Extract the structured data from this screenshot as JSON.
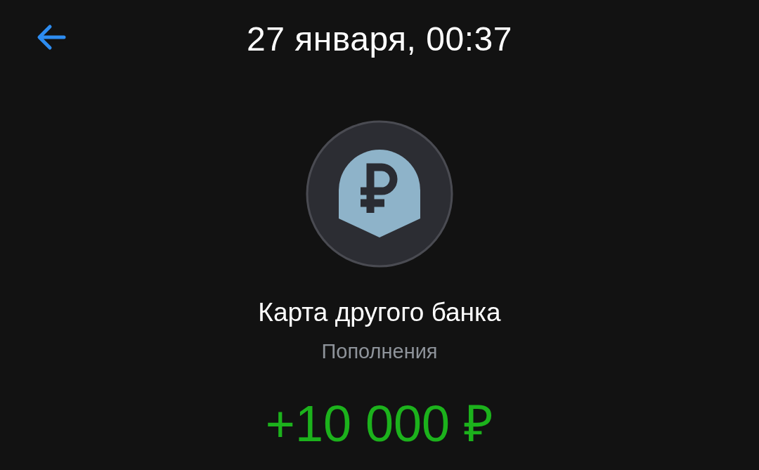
{
  "header": {
    "title": "27 января, 00:37"
  },
  "operation": {
    "name": "Карта другого банка",
    "category": "Пополнения",
    "amount": "+10 000 ₽",
    "kind": "income"
  }
}
